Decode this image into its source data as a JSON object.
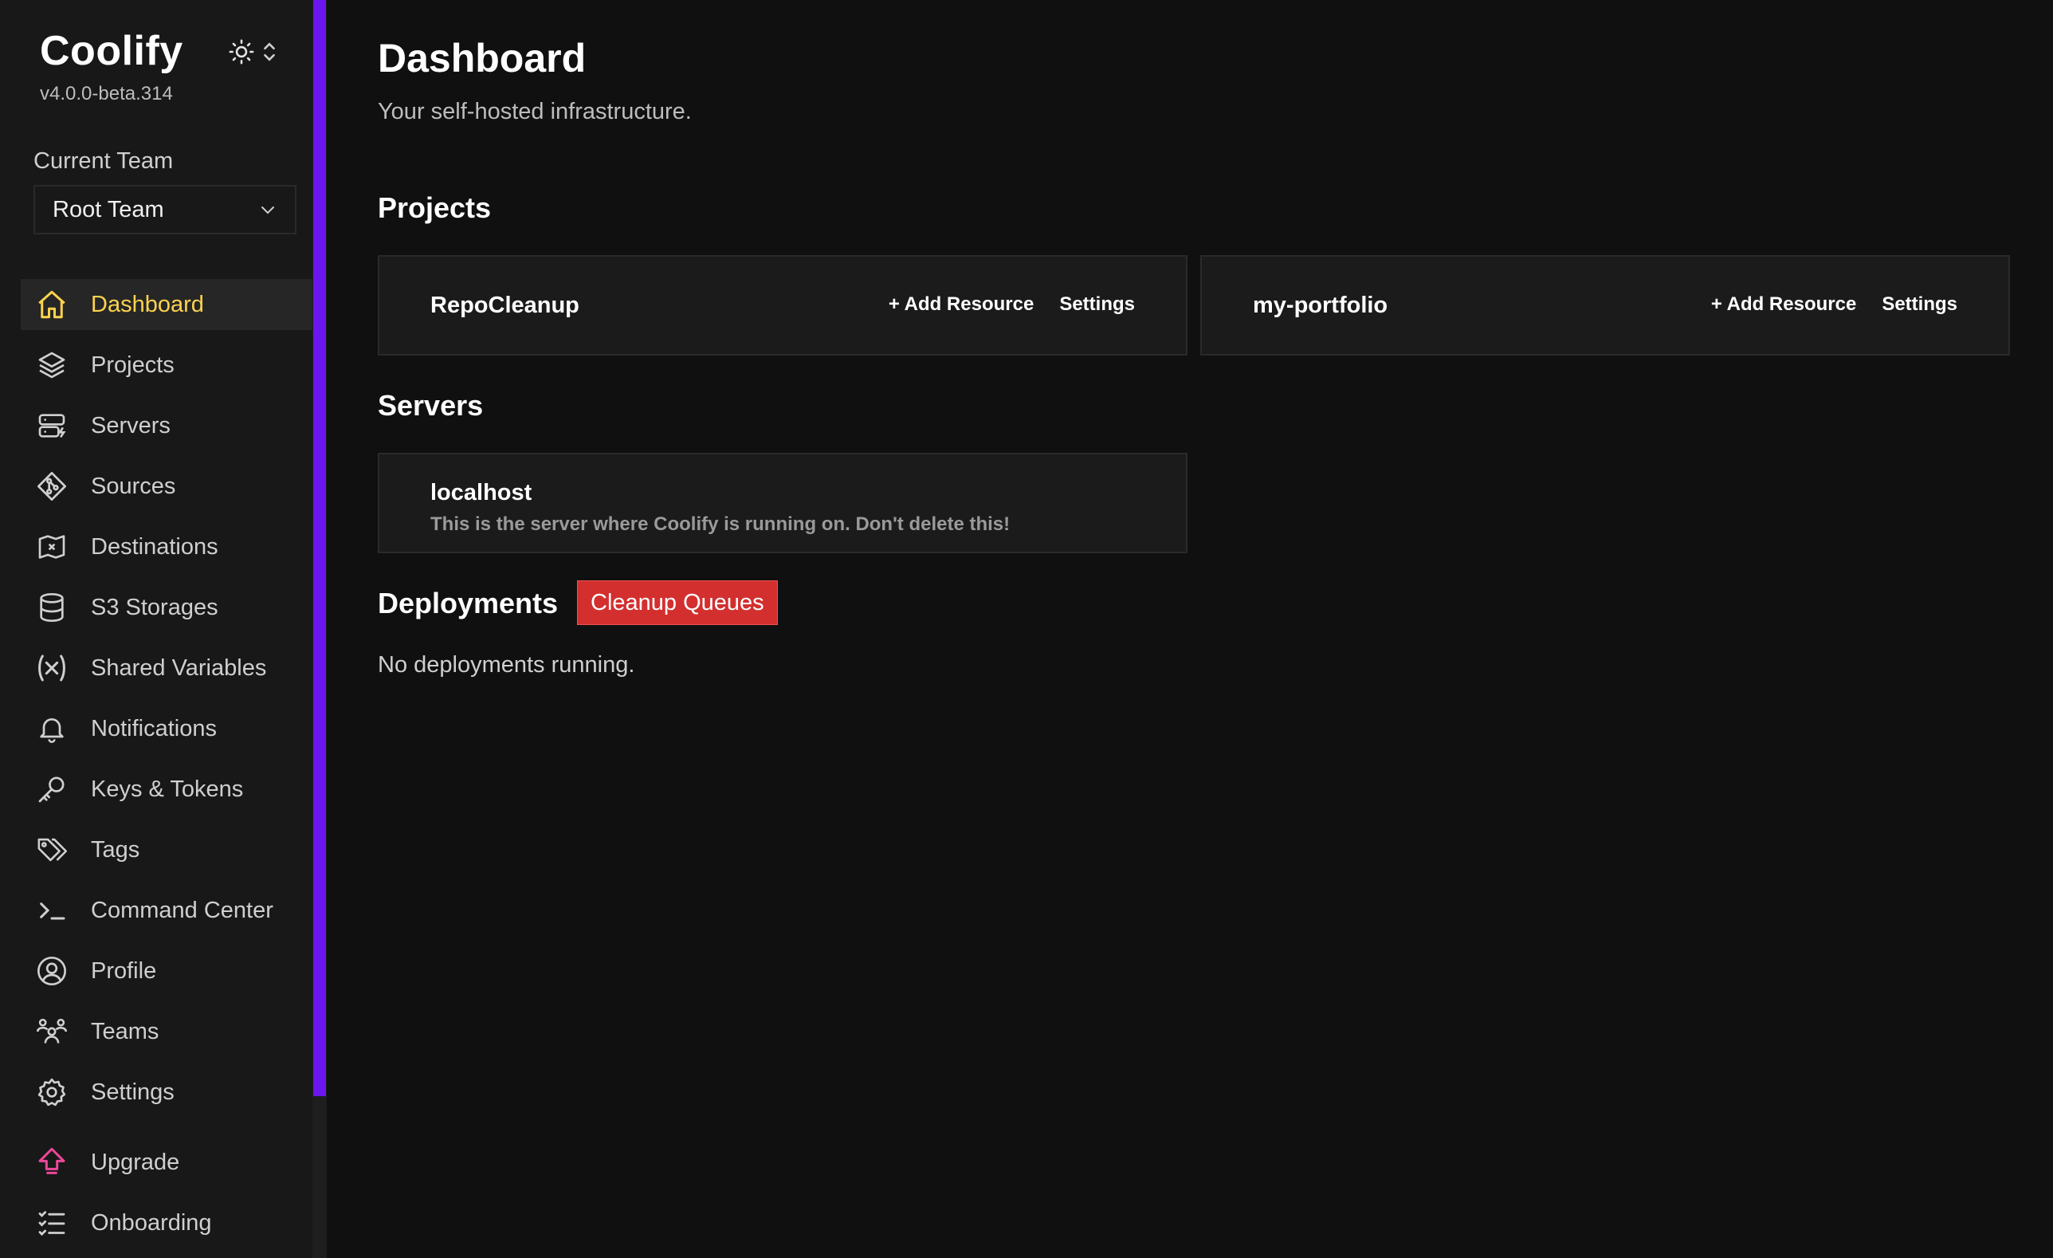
{
  "brand": {
    "name": "Coolify",
    "version": "v4.0.0-beta.314"
  },
  "team": {
    "label": "Current Team",
    "selected": "Root Team"
  },
  "nav": [
    {
      "label": "Dashboard",
      "icon": "home-icon",
      "active": true
    },
    {
      "label": "Projects",
      "icon": "layers-icon"
    },
    {
      "label": "Servers",
      "icon": "server-icon"
    },
    {
      "label": "Sources",
      "icon": "git-icon"
    },
    {
      "label": "Destinations",
      "icon": "destination-icon"
    },
    {
      "label": "S3 Storages",
      "icon": "database-icon"
    },
    {
      "label": "Shared Variables",
      "icon": "variable-icon"
    },
    {
      "label": "Notifications",
      "icon": "bell-icon"
    },
    {
      "label": "Keys & Tokens",
      "icon": "key-icon"
    },
    {
      "label": "Tags",
      "icon": "tags-icon"
    },
    {
      "label": "Command Center",
      "icon": "terminal-icon"
    },
    {
      "label": "Profile",
      "icon": "user-icon"
    },
    {
      "label": "Teams",
      "icon": "users-icon"
    },
    {
      "label": "Settings",
      "icon": "gear-icon"
    },
    {
      "label": "Upgrade",
      "icon": "upgrade-icon"
    },
    {
      "label": "Onboarding",
      "icon": "checklist-icon"
    }
  ],
  "header": {
    "title": "Dashboard",
    "subtitle": "Your self-hosted infrastructure."
  },
  "projects": {
    "title": "Projects",
    "items": [
      {
        "name": "RepoCleanup",
        "add_label": "+ Add Resource",
        "settings_label": "Settings"
      },
      {
        "name": "my-portfolio",
        "add_label": "+ Add Resource",
        "settings_label": "Settings"
      }
    ]
  },
  "servers": {
    "title": "Servers",
    "items": [
      {
        "name": "localhost",
        "description": "This is the server where Coolify is running on. Don't delete this!"
      }
    ]
  },
  "deployments": {
    "title": "Deployments",
    "cleanup_label": "Cleanup Queues",
    "empty_text": "No deployments running."
  },
  "colors": {
    "accent": "#6b16ed",
    "active": "#fcd34d",
    "danger": "#d32f2f",
    "upgrade": "#ec4899"
  }
}
